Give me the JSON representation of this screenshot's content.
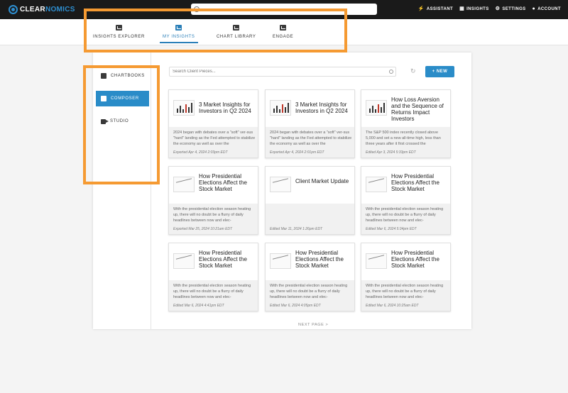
{
  "app": {
    "logo_prefix": "CLEAR",
    "logo_suffix": "NOMICS",
    "search_placeholder": "",
    "brand_color": "#2a8cc8",
    "highlight_color": "#f59a32"
  },
  "topnav": [
    {
      "label": "ASSISTANT",
      "icon": "bolt-icon"
    },
    {
      "label": "INSIGHTS",
      "icon": "chart-icon"
    },
    {
      "label": "SETTINGS",
      "icon": "gear-icon"
    },
    {
      "label": "ACCOUNT",
      "icon": "user-icon"
    }
  ],
  "subnav": [
    {
      "label": "INSIGHTS EXPLORER",
      "icon": "grid-icon",
      "active": false
    },
    {
      "label": "MY INSIGHTS",
      "icon": "chart-square-icon",
      "active": true
    },
    {
      "label": "CHART LIBRARY",
      "icon": "library-icon",
      "active": false
    },
    {
      "label": "ENGAGE",
      "icon": "engage-icon",
      "active": false
    }
  ],
  "sidebar": [
    {
      "label": "CHARTBOOKS",
      "icon": "chartbook-icon",
      "active": false
    },
    {
      "label": "COMPOSER",
      "icon": "document-icon",
      "active": true
    },
    {
      "label": "STUDIO",
      "icon": "video-icon",
      "active": false
    }
  ],
  "toolbar": {
    "search_placeholder": "Search Client Pieces...",
    "new_label": "+ NEW"
  },
  "cards": [
    {
      "title": "3 Market Insights for Investors in Q2 2024",
      "desc": "2024 began with debates over a \"soft\" ver-sus \"hard\" landing as the Fed attempted to stabilize the economy as well as over the",
      "meta": "Exported Apr 4, 2024 2:03pm EDT",
      "thumb": "bars"
    },
    {
      "title": "3 Market Insights for Investors in Q2 2024",
      "desc": "2024 began with debates over a \"soft\" ver-sus \"hard\" landing as the Fed attempted to stabilize the economy as well as over the",
      "meta": "Exported Apr 4, 2024 2:01pm EDT",
      "thumb": "bars"
    },
    {
      "title": "How Loss Aversion and the Sequence of Returns Impact Investors",
      "desc": "The S&P 500 index recently closed above 5,000 and set a new all-time high, less than three years after it first crossed the",
      "meta": "Edited Apr 3, 2024 5:33pm EDT",
      "thumb": "bars"
    },
    {
      "title": "How Presidential Elections Affect the Stock Market",
      "desc": "With the presidential election season heating up, there will no doubt be a flurry of daily headlines between now and elec-",
      "meta": "Exported Mar 25, 2024 10:21am EDT",
      "thumb": "line"
    },
    {
      "title": "Client Market Update",
      "desc": "",
      "meta": "Edited Mar 11, 2024 1:26pm EDT",
      "thumb": "line"
    },
    {
      "title": "How Presidential Elections Affect the Stock Market",
      "desc": "With the presidential election season heating up, there will no doubt be a flurry of daily headlines between now and elec-",
      "meta": "Edited Mar 6, 2024 5:34pm EDT",
      "thumb": "line"
    },
    {
      "title": "How Presidential Elections Affect the Stock Market",
      "desc": "With the presidential election season heating up, there will no doubt be a flurry of daily headlines between now and elec-",
      "meta": "Edited Mar 6, 2024 4:41pm EDT",
      "thumb": "line"
    },
    {
      "title": "How Presidential Elections Affect the Stock Market",
      "desc": "With the presidential election season heating up, there will no doubt be a flurry of daily headlines between now and elec-",
      "meta": "Edited Mar 6, 2024 4:05pm EDT",
      "thumb": "line"
    },
    {
      "title": "How Presidential Elections Affect the Stock Market",
      "desc": "With the presidential election season heating up, there will no doubt be a flurry of daily headlines between now and elec-",
      "meta": "Edited Mar 6, 2024 10:25am EDT",
      "thumb": "line"
    }
  ],
  "pagination": {
    "next_label": "NEXT PAGE >"
  }
}
